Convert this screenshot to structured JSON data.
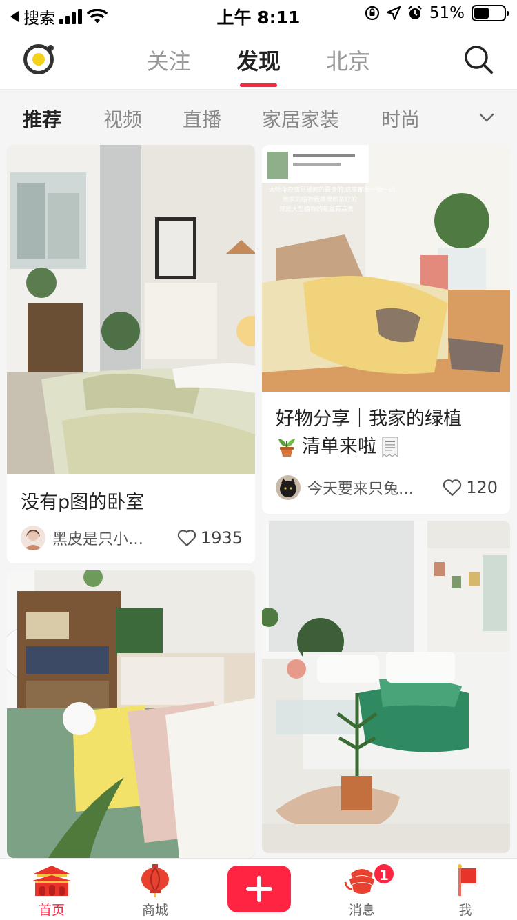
{
  "status_bar": {
    "back_app": "搜索",
    "time": "上午 8:11",
    "battery": "51%",
    "battery_level": 0.51
  },
  "header": {
    "tabs": [
      {
        "label": "关注"
      },
      {
        "label": "发现",
        "active": true
      },
      {
        "label": "北京"
      }
    ]
  },
  "categories": [
    "推荐",
    "视频",
    "直播",
    "家居家装",
    "时尚"
  ],
  "feed": {
    "left": [
      {
        "title": "没有p图的卧室",
        "author": "黑皮是只小…",
        "likes": "1935"
      },
      {
        "title": "",
        "author": "",
        "likes": ""
      }
    ],
    "right": [
      {
        "image_caption": "大叶伞应该是被问的最多的,这家都是一物一拍 他家的植物我感觉都蛮好的 就是大型植物的花盆有点贵",
        "title_line1": "好物分享｜我家的绿植",
        "title_line2": "清单来啦",
        "author": "今天要来只兔…",
        "likes": "120"
      }
    ]
  },
  "tab_bar": {
    "items": [
      {
        "label": "首页",
        "active": true
      },
      {
        "label": "商城"
      },
      {
        "label": ""
      },
      {
        "label": "消息",
        "badge": "1"
      },
      {
        "label": "我"
      }
    ]
  },
  "colors": {
    "accent": "#ff2442",
    "background": "#f5f5f5"
  }
}
